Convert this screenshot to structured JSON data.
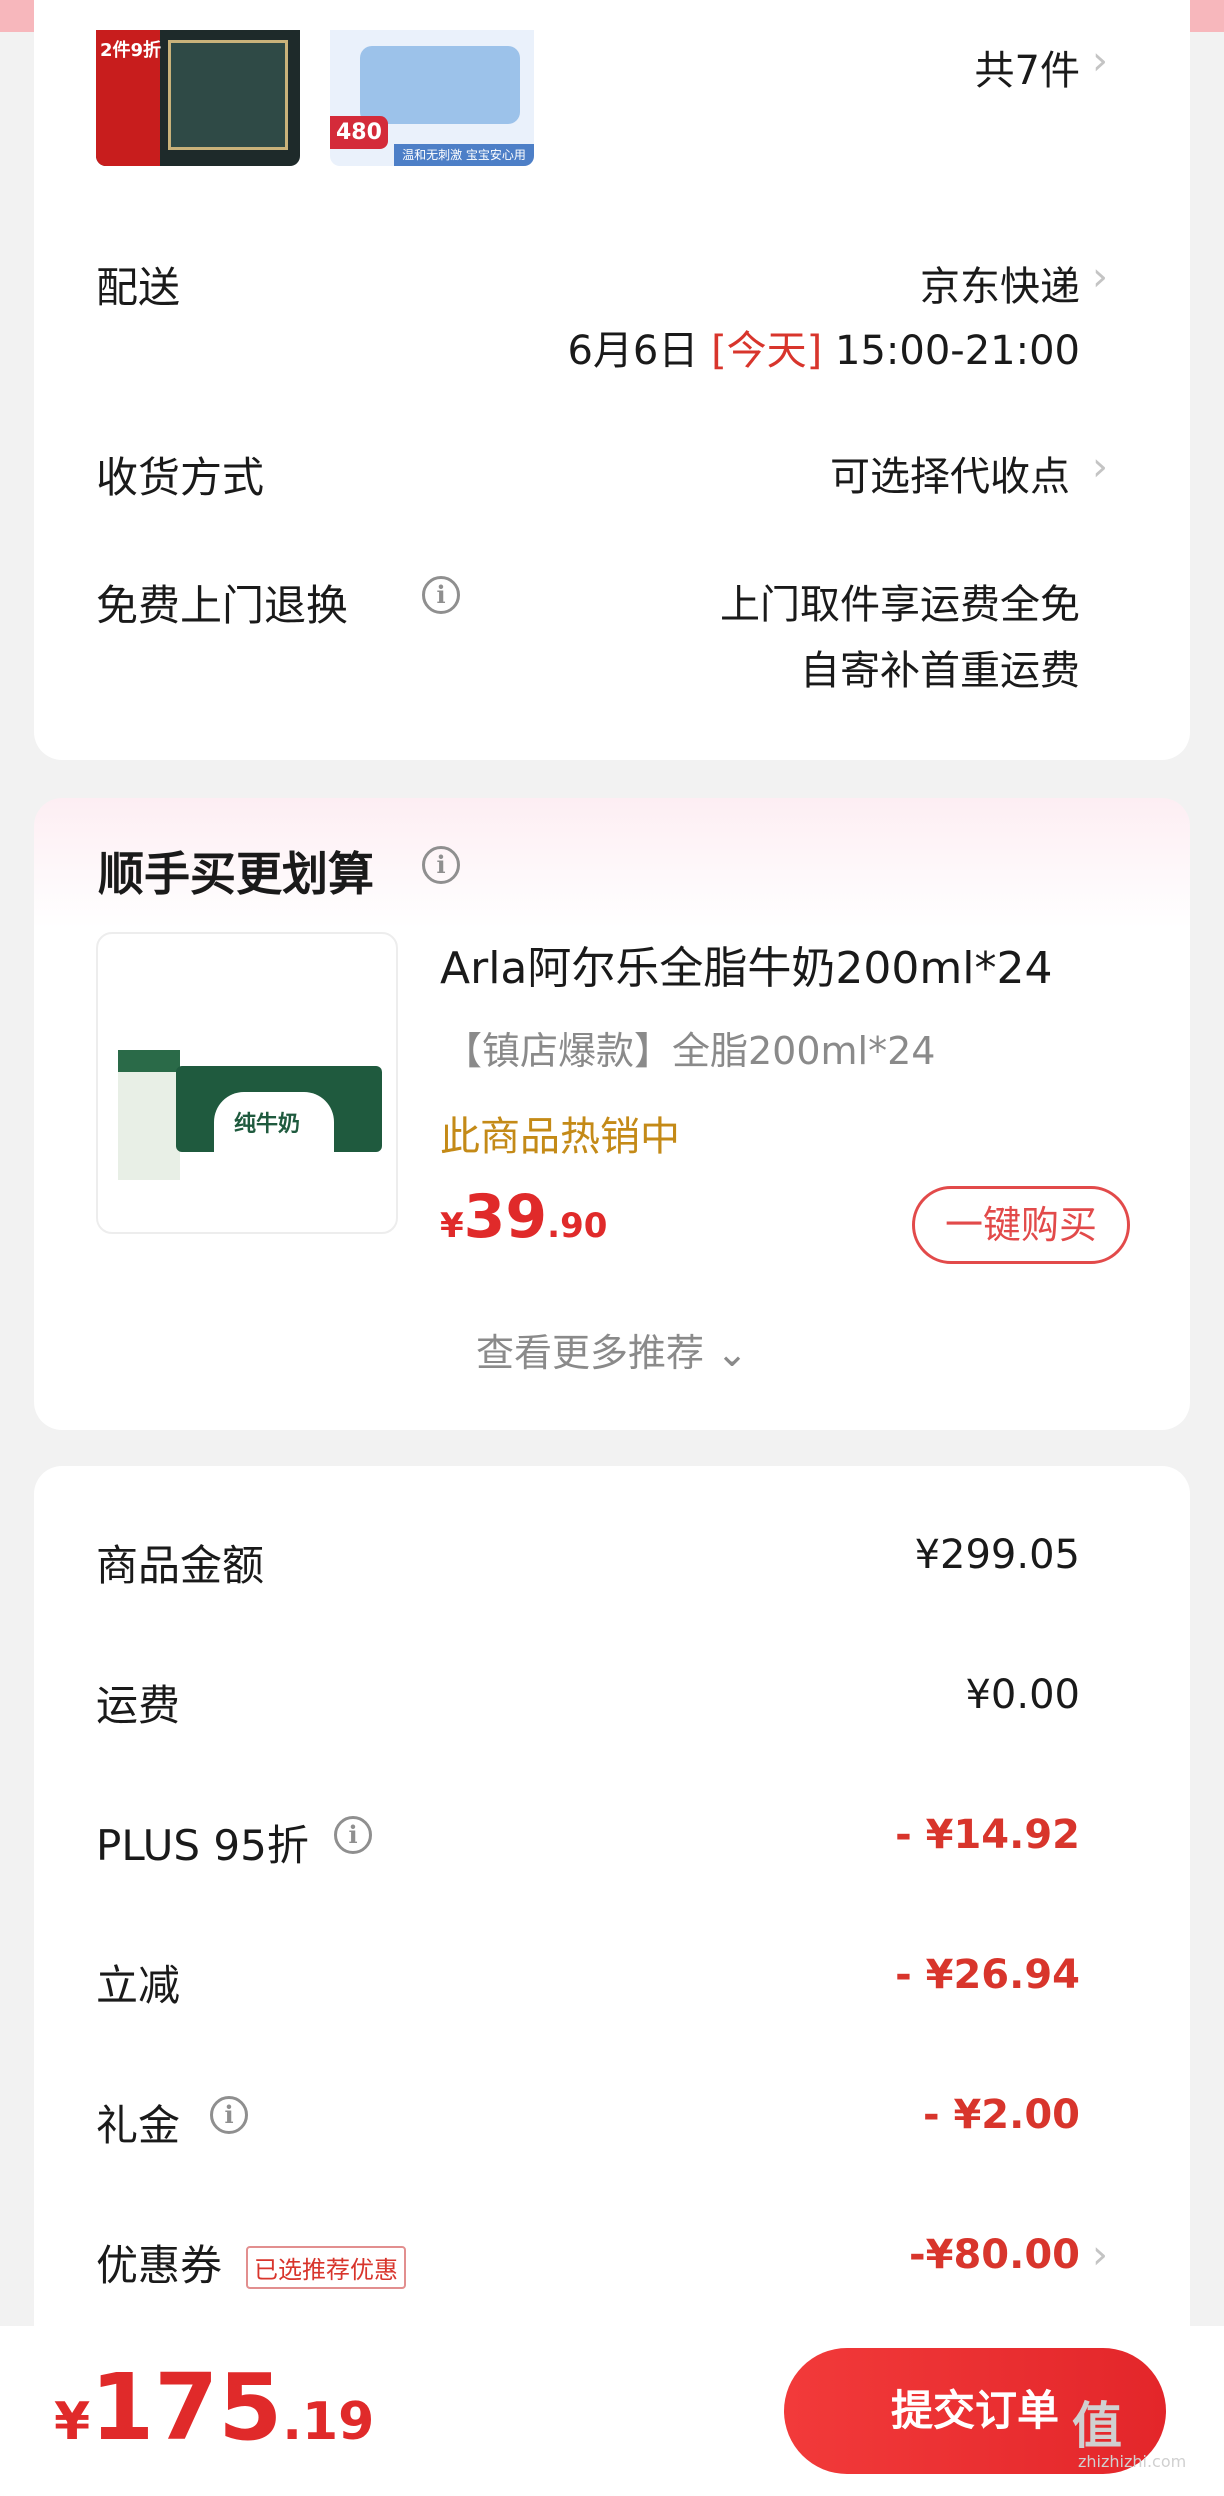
{
  "delivery": {
    "item_count": "共7件",
    "thumb1_tag": "2件9折",
    "thumb2_badge": "480",
    "thumb2_caption": "温和无刺激 宝宝安心用",
    "shipping_label": "配送",
    "shipping_value": "京东快递",
    "date_prefix": "6月6日",
    "date_today": "[今天]",
    "date_time": "15:00-21:00",
    "receive_label": "收货方式",
    "receive_value": "可选择代收点",
    "return_label": "免费上门退换",
    "return_line1": "上门取件享运费全免",
    "return_line2": "自寄补首重运费"
  },
  "recommend": {
    "title": "顺手买更划算",
    "product_name": "Arla阿尔乐全脂牛奶200ml*24",
    "product_sub": "【镇店爆款】全脂200ml*24",
    "product_hot": "此商品热销中",
    "price_currency": "¥",
    "price_int": "39",
    "price_dec": ".90",
    "buy_label": "一键购买",
    "box_text": "纯牛奶",
    "more_label": "查看更多推荐 ⌄"
  },
  "amounts": {
    "rows": [
      {
        "label": "商品金额",
        "value": "¥299.05"
      },
      {
        "label": "运费",
        "value": "¥0.00"
      },
      {
        "label": "PLUS 95折",
        "value": "- ¥14.92"
      },
      {
        "label": "立减",
        "value": "- ¥26.94"
      },
      {
        "label": "礼金",
        "value": "- ¥2.00"
      },
      {
        "label": "优惠券",
        "value": "-¥80.00"
      }
    ],
    "coupon_tag": "已选推荐优惠"
  },
  "footer": {
    "total_currency": "¥",
    "total_int": "175",
    "total_dec": ".19",
    "submit_label": "提交订单",
    "watermark": "值",
    "watermark_sub": "zhizhizhi.com"
  },
  "icons": {
    "chevron": "chevron-right-icon",
    "info": "info-icon"
  },
  "colors": {
    "accent_red": "#d8352c",
    "hot_gold": "#c48a17"
  }
}
